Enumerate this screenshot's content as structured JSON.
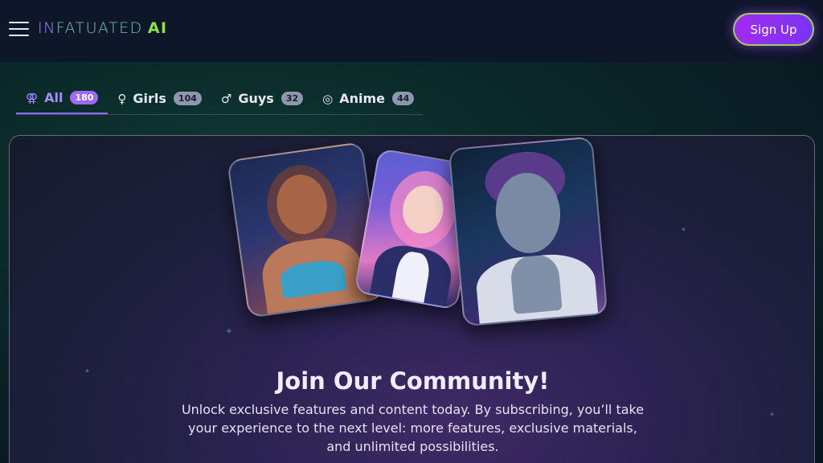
{
  "header": {
    "menu_icon": "hamburger-icon",
    "logo": {
      "part1": "IN",
      "part2": "FATUATED",
      "part3": "AI"
    },
    "signup_label": "Sign Up"
  },
  "tabs": [
    {
      "label": "All",
      "count": "180",
      "icon": "⚢",
      "icon_name": "all-genders-icon",
      "active": true
    },
    {
      "label": "Girls",
      "count": "104",
      "icon": "♀",
      "icon_name": "female-icon",
      "active": false
    },
    {
      "label": "Guys",
      "count": "32",
      "icon": "♂",
      "icon_name": "male-icon",
      "active": false
    },
    {
      "label": "Anime",
      "count": "44",
      "icon": "◎",
      "icon_name": "anime-icon",
      "active": false
    }
  ],
  "banner": {
    "title": "Join Our Community!",
    "description": "Unlock exclusive features and content today. By subscribing, you’ll take your experience to the next level: more features, exclusive materials, and unlimited possibilities."
  },
  "colors": {
    "accent": "#8a6cf5",
    "signup_gradient_start": "#a12bf0",
    "signup_gradient_end": "#7a34f4",
    "logo_ai": "#8fe04a"
  }
}
